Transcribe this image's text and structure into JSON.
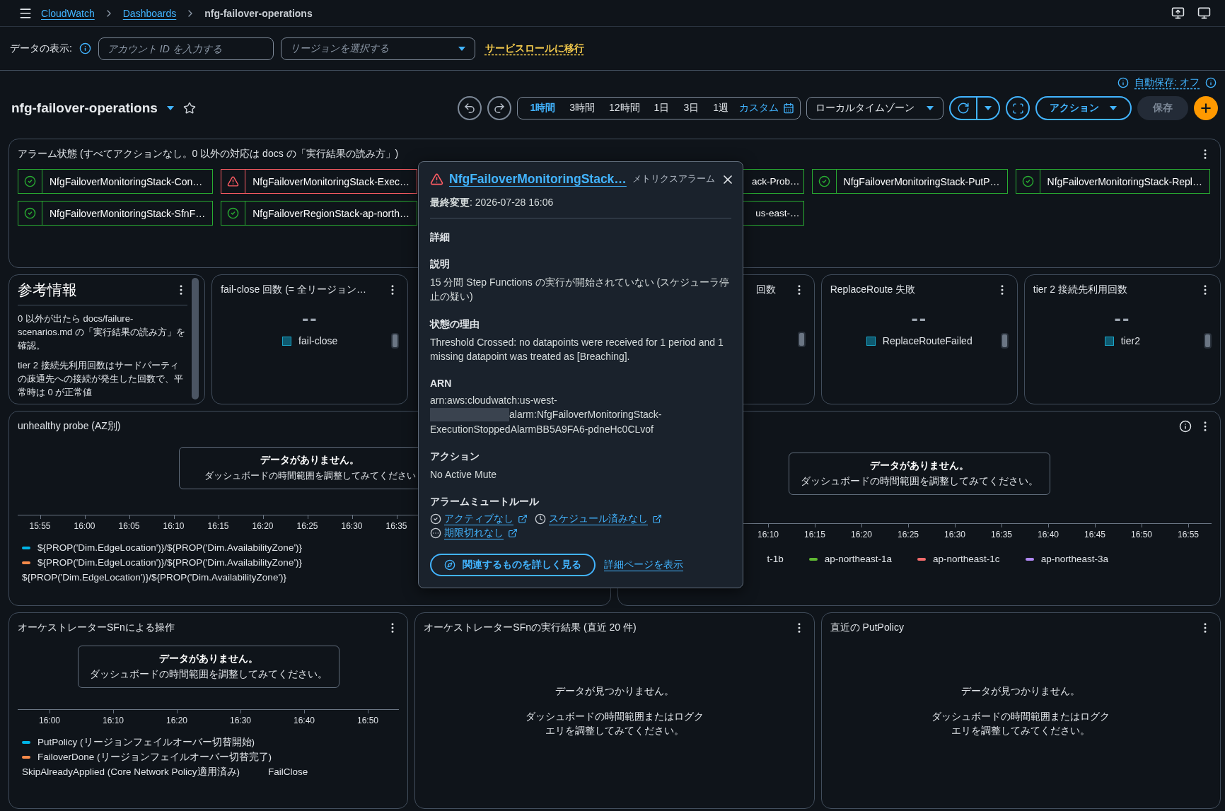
{
  "header": {
    "breadcrumbs": [
      {
        "label": "CloudWatch",
        "kind": "link"
      },
      {
        "label": "Dashboards",
        "kind": "link"
      },
      {
        "label": "nfg-failover-operations",
        "kind": "current"
      }
    ]
  },
  "filter_bar": {
    "label": "データの表示:",
    "account_field": {
      "placeholder": "アカウント ID を入力する"
    },
    "region_select": {
      "placeholder": "リージョンを選択する"
    },
    "migrate_link": "サービスロールに移行"
  },
  "autosave": "自動保存: オフ",
  "dashboard": {
    "title": "nfg-failover-operations",
    "favorite": false
  },
  "time_ranges": [
    {
      "label": "1時間",
      "selected": true
    },
    {
      "label": "3時間",
      "selected": false
    },
    {
      "label": "12時間",
      "selected": false
    },
    {
      "label": "1日",
      "selected": false
    },
    {
      "label": "3日",
      "selected": false
    },
    {
      "label": "1週",
      "selected": false
    }
  ],
  "custom_range": "カスタム",
  "timezone": "ローカルタイムゾーン",
  "actions": "アクション",
  "save": {
    "label": "保存",
    "disabled": true
  },
  "alarm_panel": {
    "title": "アラーム状態 (すべてアクションなし。0 以外の対応は docs の「実行結果の読み方」)",
    "alarms": [
      {
        "kind": "full",
        "alarm": false,
        "name": "NfgFailoverMonitoringStack-Con…"
      },
      {
        "kind": "full",
        "alarm": true,
        "name": "NfgFailoverMonitoringStack-Exec…"
      },
      {
        "kind": "covered"
      },
      {
        "kind": "partial",
        "alarm": false,
        "name": "ack-Prob…"
      },
      {
        "kind": "full",
        "alarm": false,
        "name": "NfgFailoverMonitoringStack-PutP…"
      },
      {
        "kind": "full",
        "alarm": false,
        "name": "NfgFailoverMonitoringStack-Repl…"
      },
      {
        "kind": "full",
        "alarm": false,
        "name": "NfgFailoverMonitoringStack-SfnF…"
      },
      {
        "kind": "full",
        "alarm": false,
        "name": "NfgFailoverRegionStack-ap-north…"
      },
      {
        "kind": "covered"
      },
      {
        "kind": "partial",
        "alarm": false,
        "name": "us-east-…"
      }
    ]
  },
  "widgets": [
    {
      "kind": "text",
      "title": "参考情報",
      "paragraphs": [
        "0 以外が出たら docs/failure-scenarios.md の「実行結果の読み方」を確認。",
        "tier 2 接続先利用回数はサードパーティの疎通先への接続が発生した回数で、平常時は 0 が正常値"
      ]
    },
    {
      "kind": "metric",
      "title": "fail-close 回数 (= 全リージョン…",
      "value": "--",
      "legend": "fail-close"
    },
    {
      "kind": "covered"
    },
    {
      "kind": "partial",
      "title": "回数"
    },
    {
      "kind": "metric",
      "title": "ReplaceRoute 失敗",
      "value": "--",
      "legend": "ReplaceRouteFailed"
    },
    {
      "kind": "metric",
      "title": "tier 2 接続先利用回数",
      "value": "--",
      "legend": "tier2"
    }
  ],
  "wide_charts": [
    {
      "title": "unhealthy probe (AZ別)",
      "no_data": {
        "title": "データがありません。",
        "message": "ダッシュボードの時間範囲を調整してみてください"
      },
      "ticks": [
        "15:55",
        "16:00",
        "16:05",
        "16:10",
        "16:15",
        "16:20",
        "16:25",
        "16:30",
        "16:35"
      ],
      "legend": [
        {
          "label": "${PROP('Dim.EdgeLocation')}/${PROP('Dim.AvailabilityZone')}",
          "color": "#00b4e6"
        },
        {
          "label": "${PROP('Dim.EdgeLocation')}/${PROP('Dim.AvailabilityZone')}",
          "color": "#f78a4a"
        },
        {
          "label": "${PROP('Dim.EdgeLocation')}/${PROP('Dim.AvailabilityZone')}"
        }
      ]
    },
    {
      "info": true,
      "menu": true,
      "no_data": {
        "title": "データがありません。",
        "message": "ダッシュボードの時間範囲を調整してみてください。"
      },
      "ticks": [
        "16:10",
        "16:15",
        "16:20",
        "16:25",
        "16:30",
        "16:35",
        "16:40",
        "16:45",
        "16:50",
        "16:55"
      ],
      "legend": [
        {
          "label": "t-1b"
        },
        {
          "label": "ap-northeast-1a",
          "color": "#5fb832"
        },
        {
          "label": "ap-northeast-1c",
          "color": "#f26b6b"
        },
        {
          "label": "ap-northeast-3a",
          "color": "#b088f5"
        }
      ]
    }
  ],
  "panels": [
    {
      "kind": "chart",
      "title": "オーケストレーターSFnによる操作",
      "no_data": {
        "title": "データがありません。",
        "message": "ダッシュボードの時間範囲を調整してみてください。"
      },
      "ticks": [
        "16:00",
        "16:10",
        "16:20",
        "16:30",
        "16:40",
        "16:50"
      ],
      "legend": [
        {
          "label": "PutPolicy (リージョンフェイルオーバー切替開始)",
          "color": "#00b4e6"
        },
        {
          "label": "FailoverDone (リージョンフェイルオーバー切替完了)",
          "color": "#f78a4a"
        },
        {
          "label": "SkipAlreadyApplied (Core Network Policy適用済み)"
        },
        {
          "label": "FailClose"
        }
      ]
    },
    {
      "kind": "log",
      "title": "オーケストレーターSFnの実行結果 (直近 20 件)",
      "message": "データが見つかりません。",
      "hint": "ダッシュボードの時間範囲またはログクエリを調整してみてください。"
    },
    {
      "kind": "log",
      "title": "直近の PutPolicy",
      "message": "データが見つかりません。",
      "hint": "ダッシュボードの時間範囲またはログクエリを調整してみてください。"
    }
  ],
  "popover": {
    "title": "NfgFailoverMonitoringStack…",
    "type": "メトリクスアラーム",
    "alarm": true,
    "last_modified": "**最終変更**: 2026-07-28 16:06",
    "section": "詳細",
    "fields": [
      {
        "kind": "text",
        "label": "説明",
        "value": "15 分間 Step Functions の実行が開始されていない (スケジューラ停止の疑い)"
      },
      {
        "kind": "text",
        "label": "状態の理由",
        "value": "Threshold Crossed: no datapoints were received for 1 period and 1 missing datapoint was treated as [Breaching]."
      },
      {
        "kind": "redacted",
        "label": "ARN",
        "lines": [
          "arn:aws:cloudwatch:us-west-",
          "alarm:NfgFailoverMonitoringStack-",
          "ExecutionStoppedAlarmBB5A9FA6-pdneHc0CLvof"
        ]
      },
      {
        "kind": "text",
        "label": "アクション",
        "value": "No Active Mute"
      }
    ],
    "mute_rules": {
      "label": "アラームミュートルール",
      "links": [
        {
          "kind": "active",
          "label": "アクティブなし"
        },
        {
          "kind": "scheduled",
          "label": "スケジュール済みなし"
        },
        {
          "kind": "expired",
          "label": "期限切れなし"
        }
      ]
    },
    "explore_button": "関連するものを詳しく見る",
    "details_link": "詳細ページを表示"
  }
}
